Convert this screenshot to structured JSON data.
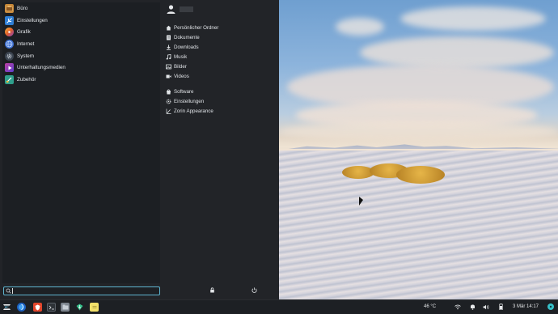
{
  "menu": {
    "categories": [
      {
        "label": "Büro",
        "icon": "briefcase-icon",
        "color": "#c98a3a"
      },
      {
        "label": "Einstellungen",
        "icon": "settings-icon",
        "color": "#2f7fd6"
      },
      {
        "label": "Grafik",
        "icon": "graphics-icon",
        "color": "#e0602c"
      },
      {
        "label": "Internet",
        "icon": "globe-icon",
        "color": "#3d6fd1"
      },
      {
        "label": "System",
        "icon": "system-icon",
        "color": "#6d7a89"
      },
      {
        "label": "Unterhaltungsmedien",
        "icon": "media-icon",
        "color": "#8a3fc0"
      },
      {
        "label": "Zubehör",
        "icon": "accessories-icon",
        "color": "#2f9f8c"
      }
    ],
    "search": {
      "value": "",
      "placeholder": ""
    },
    "places": [
      {
        "label": "Persönlicher Ordner",
        "icon": "home-icon"
      },
      {
        "label": "Dokumente",
        "icon": "document-icon"
      },
      {
        "label": "Downloads",
        "icon": "download-icon"
      },
      {
        "label": "Musik",
        "icon": "music-icon"
      },
      {
        "label": "Bilder",
        "icon": "image-icon"
      },
      {
        "label": "Videos",
        "icon": "video-icon"
      }
    ],
    "system_items": [
      {
        "label": "Software",
        "icon": "software-icon"
      },
      {
        "label": "Einstellungen",
        "icon": "gear-icon"
      },
      {
        "label": "Zorin Appearance",
        "icon": "appearance-icon"
      }
    ]
  },
  "taskbar": {
    "temperature": "46 °C",
    "datetime": "3 Mär 14:17"
  }
}
